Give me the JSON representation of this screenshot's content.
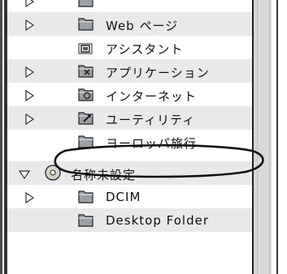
{
  "window": {
    "rows": [
      {
        "label": "",
        "expander": "right",
        "icon": "folder-icon",
        "level": 1,
        "shaded": false
      },
      {
        "label": "Web ページ",
        "expander": "right",
        "icon": "folder-icon",
        "level": 1,
        "shaded": true
      },
      {
        "label": "アシスタント",
        "expander": "none",
        "icon": "assistant-folder-icon",
        "level": 1,
        "shaded": false
      },
      {
        "label": "アプリケーション",
        "expander": "right",
        "icon": "applications-folder-icon",
        "level": 1,
        "shaded": true
      },
      {
        "label": "インターネット",
        "expander": "right",
        "icon": "internet-folder-icon",
        "level": 1,
        "shaded": false
      },
      {
        "label": "ユーティリティ",
        "expander": "right",
        "icon": "utilities-folder-icon",
        "level": 1,
        "shaded": true
      },
      {
        "label": "ヨーロッパ旅行",
        "expander": "none",
        "icon": "folder-icon",
        "level": 1,
        "shaded": false
      },
      {
        "label": "名称未設定",
        "expander": "down",
        "icon": "cd-icon",
        "level": 0,
        "shaded": true
      },
      {
        "label": "DCIM",
        "expander": "right",
        "icon": "folder-icon",
        "level": 1,
        "shaded": false
      },
      {
        "label": "Desktop Folder",
        "expander": "none",
        "icon": "folder-icon",
        "level": 1,
        "shaded": true
      }
    ]
  },
  "colors": {
    "row_shade": "#e9e9e9",
    "folder_fill": "#9aa0a6",
    "frame_dark": "#333333",
    "highlight_ellipse": "#111111"
  }
}
